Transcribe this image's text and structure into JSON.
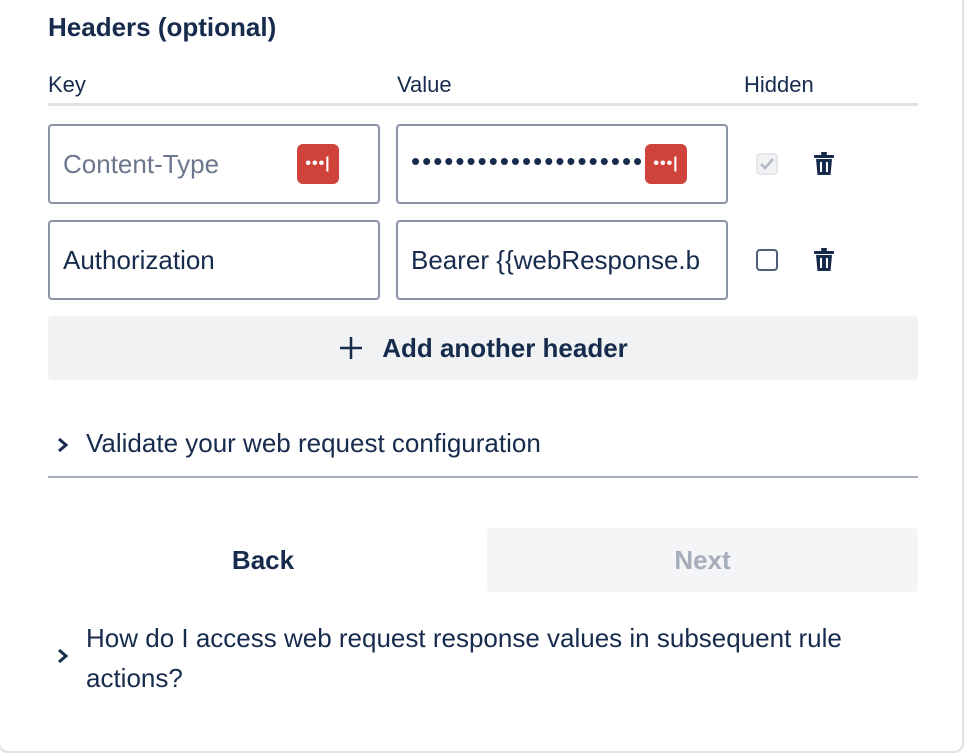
{
  "section": {
    "title": "Headers (optional)"
  },
  "columns": {
    "key": "Key",
    "value": "Value",
    "hidden": "Hidden"
  },
  "headers": [
    {
      "key_placeholder": "Content-Type",
      "value": "••••••••••••••••••••••",
      "hidden": true,
      "hidden_disabled": true,
      "password_manager_icon": "password-manager-icon"
    },
    {
      "key": "Authorization",
      "value": "Bearer {{webResponse.b",
      "hidden": false
    }
  ],
  "password_badge": "•••|",
  "add_button": {
    "icon": "plus-icon",
    "label": "Add another header"
  },
  "validate": {
    "icon": "chevron-right-icon",
    "label": "Validate your web request configuration"
  },
  "nav": {
    "back": "Back",
    "next": "Next",
    "next_disabled": true
  },
  "faq": {
    "icon": "chevron-right-icon",
    "label": "How do I access web request response values in subsequent rule actions?"
  },
  "colors": {
    "text": "#172b4d",
    "badge": "#d0433b",
    "button_bg": "#f1f2f4",
    "disabled_text": "#a5adba"
  }
}
